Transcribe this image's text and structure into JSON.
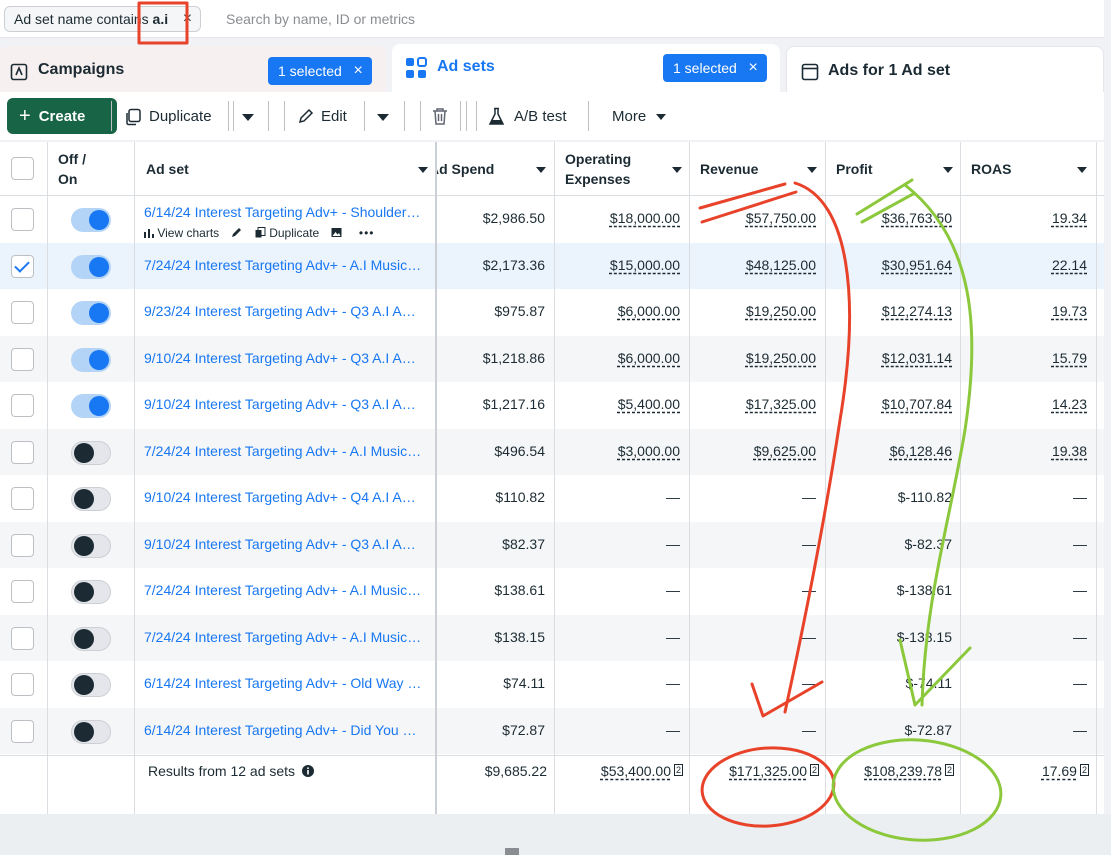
{
  "filter": {
    "chip_prefix": "Ad set name contains ",
    "chip_value": "a.i",
    "close_glyph": "×",
    "search_placeholder": "Search by name, ID or metrics"
  },
  "tabs": {
    "campaigns": {
      "label": "Campaigns",
      "selected": "1 selected"
    },
    "adsets": {
      "label": "Ad sets",
      "selected": "1 selected"
    },
    "ads": {
      "label": "Ads for 1 Ad set"
    }
  },
  "toolbar": {
    "create": "Create",
    "duplicate": "Duplicate",
    "edit": "Edit",
    "ab_test": "A/B test",
    "more": "More"
  },
  "columns": {
    "offon_line1": "Off /",
    "offon_line2": "On",
    "adset": "Ad set",
    "ad_spend": "Ad Spend",
    "opex_line1": "Operating",
    "opex_line2": "Expenses",
    "revenue": "Revenue",
    "profit": "Profit",
    "roas": "ROAS"
  },
  "row_actions": {
    "view_charts": "View charts",
    "duplicate": "Duplicate",
    "more": "•••"
  },
  "rows": [
    {
      "name": "6/14/24 Interest Targeting Adv+ - Shoulder…",
      "on": true,
      "checked": false,
      "spend": "$2,986.50",
      "opex": "$18,000.00",
      "revenue": "$57,750.00",
      "profit": "$36,763.50",
      "roas": "19.34"
    },
    {
      "name": "7/24/24 Interest Targeting Adv+ - A.I Music…",
      "on": true,
      "checked": true,
      "spend": "$2,173.36",
      "opex": "$15,000.00",
      "revenue": "$48,125.00",
      "profit": "$30,951.64",
      "roas": "22.14"
    },
    {
      "name": "9/23/24 Interest Targeting Adv+ - Q3 A.I A…",
      "on": true,
      "checked": false,
      "spend": "$975.87",
      "opex": "$6,000.00",
      "revenue": "$19,250.00",
      "profit": "$12,274.13",
      "roas": "19.73"
    },
    {
      "name": "9/10/24 Interest Targeting Adv+ - Q3 A.I A…",
      "on": true,
      "checked": false,
      "spend": "$1,218.86",
      "opex": "$6,000.00",
      "revenue": "$19,250.00",
      "profit": "$12,031.14",
      "roas": "15.79"
    },
    {
      "name": "9/10/24 Interest Targeting Adv+ - Q3 A.I A…",
      "on": true,
      "checked": false,
      "spend": "$1,217.16",
      "opex": "$5,400.00",
      "revenue": "$17,325.00",
      "profit": "$10,707.84",
      "roas": "14.23"
    },
    {
      "name": "7/24/24 Interest Targeting Adv+ - A.I Music…",
      "on": false,
      "checked": false,
      "spend": "$496.54",
      "opex": "$3,000.00",
      "revenue": "$9,625.00",
      "profit": "$6,128.46",
      "roas": "19.38"
    },
    {
      "name": "9/10/24 Interest Targeting Adv+ - Q4 A.I A…",
      "on": false,
      "checked": false,
      "spend": "$110.82",
      "opex": "—",
      "revenue": "—",
      "profit": "$-110.82",
      "roas": "—"
    },
    {
      "name": "9/10/24 Interest Targeting Adv+ - Q3 A.I A…",
      "on": false,
      "checked": false,
      "spend": "$82.37",
      "opex": "—",
      "revenue": "—",
      "profit": "$-82.37",
      "roas": "—"
    },
    {
      "name": "7/24/24 Interest Targeting Adv+ - A.I Music…",
      "on": false,
      "checked": false,
      "spend": "$138.61",
      "opex": "—",
      "revenue": "—",
      "profit": "$-138.61",
      "roas": "—"
    },
    {
      "name": "7/24/24 Interest Targeting Adv+ - A.I Music…",
      "on": false,
      "checked": false,
      "spend": "$138.15",
      "opex": "—",
      "revenue": "—",
      "profit": "$-138.15",
      "roas": "—"
    },
    {
      "name": "6/14/24 Interest Targeting Adv+ - Old Way …",
      "on": false,
      "checked": false,
      "spend": "$74.11",
      "opex": "—",
      "revenue": "—",
      "profit": "$-74.11",
      "roas": "—"
    },
    {
      "name": "6/14/24 Interest Targeting Adv+ - Did You …",
      "on": false,
      "checked": false,
      "spend": "$72.87",
      "opex": "—",
      "revenue": "—",
      "profit": "$-72.87",
      "roas": "—"
    }
  ],
  "totals": {
    "label": "Results from 12 ad sets",
    "spend": "$9,685.22",
    "opex": "$53,400.00",
    "revenue": "$171,325.00",
    "profit": "$108,239.78",
    "roas": "17.69",
    "note_glyph": "2"
  },
  "colors": {
    "accent": "#1877f2",
    "create": "#176447",
    "annotation_red": "#e8432a",
    "annotation_green": "#8cc83c"
  }
}
